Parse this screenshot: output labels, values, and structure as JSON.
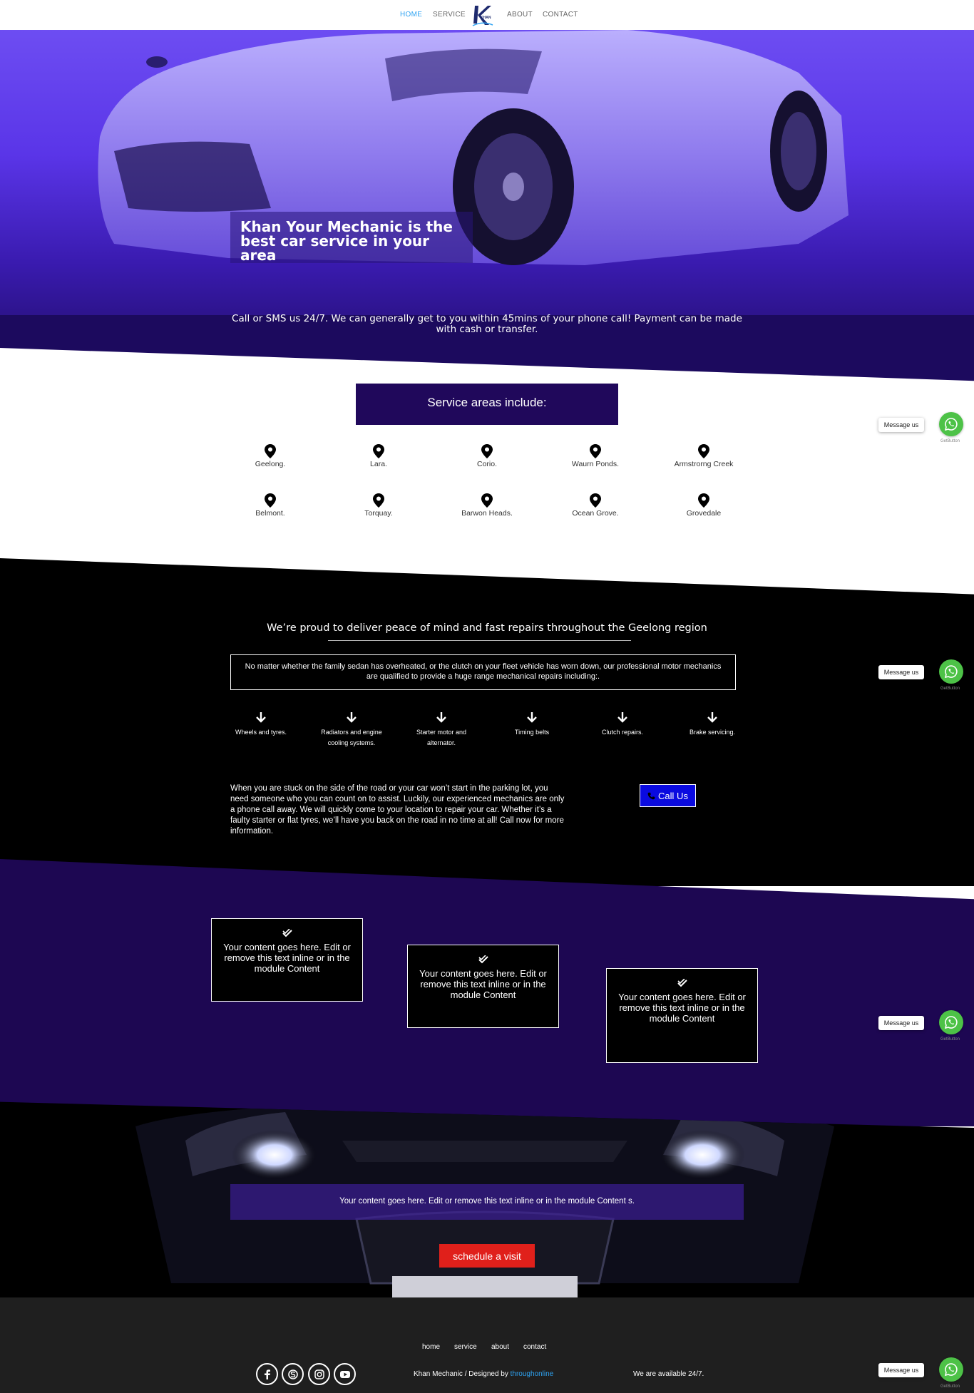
{
  "nav": {
    "items": [
      {
        "label": "HOME",
        "active": true
      },
      {
        "label": "SERVICE",
        "active": false
      },
      {
        "label": "ABOUT",
        "active": false
      },
      {
        "label": "CONTACT",
        "active": false
      }
    ],
    "logo_text": "KHAN"
  },
  "hero": {
    "title_line1": "Khan Your Mechanic is the",
    "title_line2": "best car service in your area",
    "subtitle": "Call or SMS us 24/7. We can generally get to you within 45mins of your phone call! Payment can be made with cash or transfer."
  },
  "areas": {
    "heading": "Service areas include:",
    "row1": [
      "Geelong.",
      "Lara.",
      "Corio.",
      "Waurn Ponds.",
      "Armstrorng Creek"
    ],
    "row2": [
      "Belmont.",
      "Torquay.",
      "Barwon Heads.",
      "Ocean Grove.",
      "Grovedale"
    ]
  },
  "repairs": {
    "heading": "We’re proud to deliver peace of mind and fast repairs throughout the Geelong region",
    "intro": "No matter whether the family sedan has overheated, or the clutch on your fleet vehicle has worn down, our professional motor mechanics are qualified to provide a huge range mechanical repairs including:.",
    "items": [
      "Wheels and tyres.",
      "Radiators and engine cooling systems.",
      "Starter motor and alternator.",
      "Timing belts",
      "Clutch repairs.",
      "Brake servicing."
    ],
    "stuck_text": "When you are stuck on the side of the road or your car won’t start in the parking lot, you need someone who you can count on to assist. Luckily, our experienced mechanics are only a phone call away. We will quickly come to your location to repair your car. Whether it’s a faulty starter or flat tyres, we’ll have you back on the road in no time at all! Call now for more information.",
    "call_label": "Call Us"
  },
  "cards": [
    {
      "text": "Your content goes here. Edit or remove this text inline or in the module Content"
    },
    {
      "text": "Your content goes here. Edit or remove this text inline or in the module Content"
    },
    {
      "text": "Your content goes here. Edit or remove this text inline or in the module Content"
    }
  ],
  "cta": {
    "text": "Your content goes here. Edit or remove this text inline or in the module Content s.",
    "button_label": "schedule a visit"
  },
  "footer": {
    "links": [
      "home",
      "service",
      "about",
      "contact"
    ],
    "social_icons": [
      "facebook-icon",
      "skype-icon",
      "instagram-icon",
      "youtube-icon"
    ],
    "credit_prefix": "Khan Mechanic / Designed by ",
    "credit_link": "throughonline",
    "availability": "We are available 24/7."
  },
  "whatsapp": {
    "bubble_label": "Message us",
    "brand": "GetButton"
  },
  "colors": {
    "deep_purple": "#1d0752",
    "heading_box": "#20085b",
    "call_blue": "#0a0ae0",
    "schedule_red": "#e0201b",
    "whatsapp_green": "#4dc247",
    "link_blue": "#2ea3f2"
  }
}
